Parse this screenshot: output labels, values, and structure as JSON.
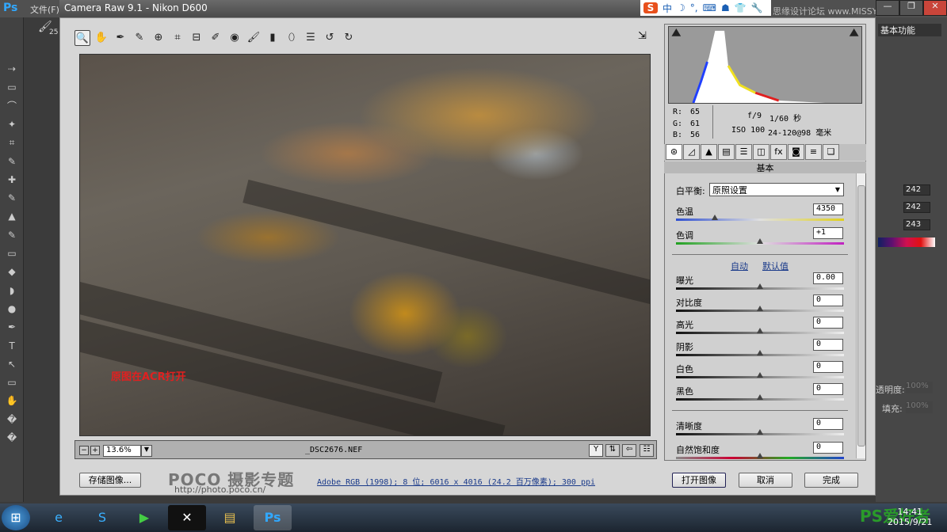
{
  "ps": {
    "logo": "Ps",
    "menu_file": "文件(F)",
    "brush_size": "25",
    "workspace": "基本功能",
    "opacity_label": "透明度:",
    "opacity": "100%",
    "fill_label": "填充:",
    "fill": "100%",
    "color_values": [
      "242",
      "242",
      "243"
    ]
  },
  "dialog": {
    "title": "Camera Raw 9.1 -  Nikon D600"
  },
  "ime": {
    "logo": "S",
    "items": [
      "中",
      "☽",
      "°,",
      "⌨",
      "☗",
      "👕",
      "🔧"
    ]
  },
  "watermark": "思缘设计论坛 www.MISSYUAN.COM",
  "toolbar": {
    "tools": [
      "zoom",
      "hand",
      "white-balance",
      "color-sampler",
      "targeted-adjustment",
      "crop",
      "straighten",
      "spot-removal",
      "red-eye",
      "adjustment-brush",
      "graduated-filter",
      "radial-filter",
      "preferences",
      "rotate-left",
      "rotate-right"
    ]
  },
  "photo": {
    "caption": "原图在ACR打开"
  },
  "status": {
    "zoom": "13.6%",
    "filename": "_DSC2676.NEF"
  },
  "info": {
    "r_label": "R:",
    "r": "65",
    "g_label": "G:",
    "g": "61",
    "b_label": "B:",
    "b": "56",
    "aperture": "f/9",
    "shutter": "1/60 秒",
    "iso": "ISO 100",
    "lens": "24-120@98 毫米"
  },
  "panel": {
    "section": "基本",
    "white_balance_label": "白平衡:",
    "white_balance": "原照设置",
    "auto": "自动",
    "default": "默认值",
    "sliders": [
      {
        "label": "色温",
        "value": "4350",
        "pos": 0.23
      },
      {
        "label": "色调",
        "value": "+1",
        "pos": 0.5
      },
      {
        "label": "曝光",
        "value": "0.00",
        "pos": 0.5
      },
      {
        "label": "对比度",
        "value": "0",
        "pos": 0.5
      },
      {
        "label": "高光",
        "value": "0",
        "pos": 0.5
      },
      {
        "label": "阴影",
        "value": "0",
        "pos": 0.5
      },
      {
        "label": "白色",
        "value": "0",
        "pos": 0.5
      },
      {
        "label": "黑色",
        "value": "0",
        "pos": 0.5
      },
      {
        "label": "清晰度",
        "value": "0",
        "pos": 0.5
      },
      {
        "label": "自然饱和度",
        "value": "0",
        "pos": 0.5
      }
    ]
  },
  "buttons": {
    "save": "存储图像...",
    "open": "打开图像",
    "cancel": "取消",
    "done": "完成"
  },
  "branding": {
    "poco": "POCO 摄影专题",
    "url": "http://photo.poco.cn/"
  },
  "meta": "Adobe RGB (1998); 8 位;  6016 x 4016 (24.2 百万像素); 300 ppi",
  "taskbar": {
    "time": "14:41",
    "date": "2015/9/21",
    "watermark": "PS爱好者"
  }
}
